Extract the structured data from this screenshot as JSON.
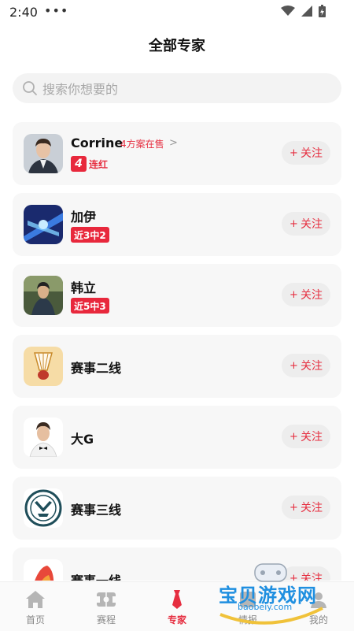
{
  "status": {
    "time": "2:40",
    "dots": "•••"
  },
  "header": {
    "title": "全部专家"
  },
  "search": {
    "placeholder": "搜索你想要的"
  },
  "experts": [
    {
      "name": "Corrine",
      "sub": "4方案在售",
      "streak_num": "4",
      "streak_label": "连红",
      "follow": "关注"
    },
    {
      "name": "加伊",
      "badge": "近3中2",
      "follow": "关注"
    },
    {
      "name": "韩立",
      "badge": "近5中3",
      "follow": "关注"
    },
    {
      "name": "赛事二线",
      "follow": "关注"
    },
    {
      "name": "大G",
      "follow": "关注"
    },
    {
      "name": "赛事三线",
      "follow": "关注"
    },
    {
      "name": "赛事一线",
      "follow": "关注"
    }
  ],
  "tabs": [
    {
      "label": "首页",
      "icon": "home-icon"
    },
    {
      "label": "赛程",
      "icon": "schedule-icon"
    },
    {
      "label": "专家",
      "icon": "tie-icon",
      "active": true
    },
    {
      "label": "情报",
      "icon": "intel-icon"
    },
    {
      "label": "我的",
      "icon": "profile-icon"
    }
  ],
  "watermark": {
    "title": "宝贝游戏网",
    "url": "baobeiy.com"
  },
  "colors": {
    "accent": "#e62e40",
    "card_bg": "#f7f7f7",
    "search_bg": "#f3f3f3"
  }
}
